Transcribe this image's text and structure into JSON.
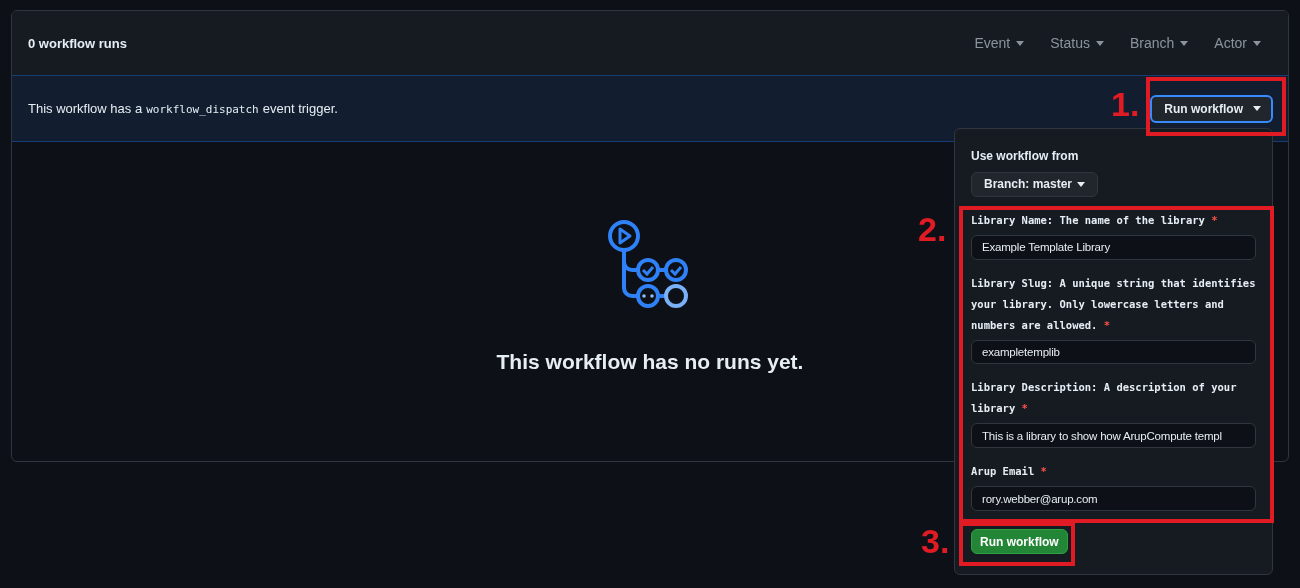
{
  "header": {
    "title": "0 workflow runs",
    "filters": [
      {
        "label": "Event"
      },
      {
        "label": "Status"
      },
      {
        "label": "Branch"
      },
      {
        "label": "Actor"
      }
    ]
  },
  "banner": {
    "text_before": "This workflow has a",
    "code": "workflow_dispatch",
    "text_after": "event trigger.",
    "button": "Run workflow"
  },
  "empty_state": {
    "message": "This workflow has no runs yet."
  },
  "popover": {
    "heading": "Use workflow from",
    "branch_button": "Branch: master",
    "inputs": [
      {
        "label": "Library Name: The name of the library",
        "required_mark": "*",
        "value": "Example Template Library"
      },
      {
        "label": "Library Slug: A unique string that identifies your library. Only lowercase letters and numbers are allowed.",
        "required_mark": "*",
        "value": "exampletemplib"
      },
      {
        "label": "Library Description: A description of your library",
        "required_mark": "*",
        "value": "This is a library to show how ArupCompute templ"
      },
      {
        "label": "Arup Email",
        "required_mark": "*",
        "value": "rory.webber@arup.com"
      }
    ],
    "submit": "Run workflow"
  },
  "annotations": [
    {
      "number": "1."
    },
    {
      "number": "2."
    },
    {
      "number": "3."
    }
  ]
}
